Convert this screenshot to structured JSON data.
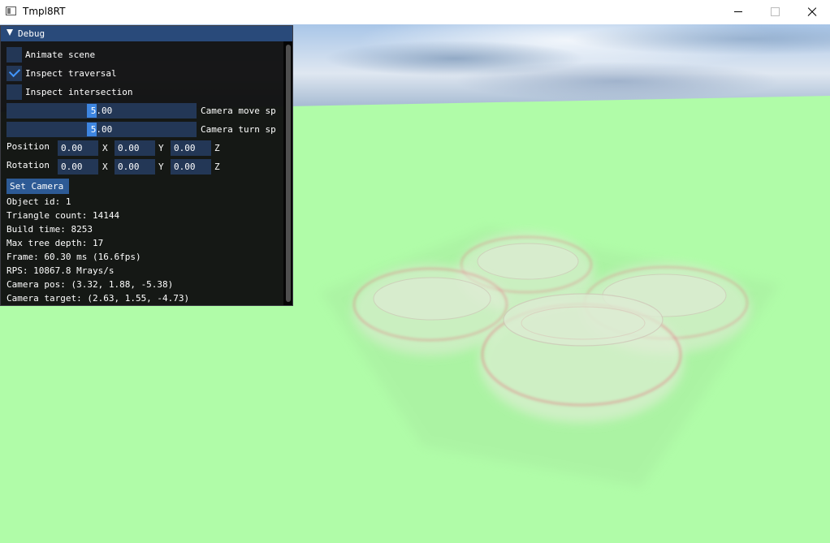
{
  "window": {
    "title": "Tmpl8RT"
  },
  "debug": {
    "title": "Debug",
    "checkboxes": [
      {
        "label": "Animate scene",
        "checked": false
      },
      {
        "label": "Inspect traversal",
        "checked": true
      },
      {
        "label": "Inspect intersection",
        "checked": false
      }
    ],
    "sliders": [
      {
        "value": "5.00",
        "label": "Camera move sp"
      },
      {
        "value": "5.00",
        "label": "Camera turn sp"
      }
    ],
    "position": {
      "label": "Position",
      "x": "0.00",
      "y": "0.00",
      "z": "0.00"
    },
    "rotation": {
      "label": "Rotation",
      "x": "0.00",
      "y": "0.00",
      "z": "0.00"
    },
    "axes": {
      "x": "X",
      "y": "Y",
      "z": "Z"
    },
    "set_camera_label": "Set Camera",
    "info": {
      "object_id": "Object id: 1",
      "triangle_count": "Triangle count: 14144",
      "build_time": "Build time: 8253",
      "max_tree_depth": "Max tree depth: 17",
      "frame": "Frame: 60.30 ms (16.6fps)",
      "rps": "RPS: 10867.8 Mrays/s",
      "camera_pos": "Camera pos: (3.32, 1.88, -5.38)",
      "camera_target": "Camera target: (2.63, 1.55, -4.73)"
    }
  },
  "colors": {
    "ground": "#b0fca8",
    "panel_bg": "#0f0f0f",
    "header": "#294a7a",
    "frame_bg": "#233756",
    "accent": "#4296fa",
    "heat": "#e8506a"
  },
  "icons": {
    "app": "window-app-icon",
    "minimize": "minimize-icon",
    "maximize": "maximize-icon",
    "close": "close-icon",
    "collapse": "triangle-down-icon",
    "check": "checkmark-icon"
  }
}
